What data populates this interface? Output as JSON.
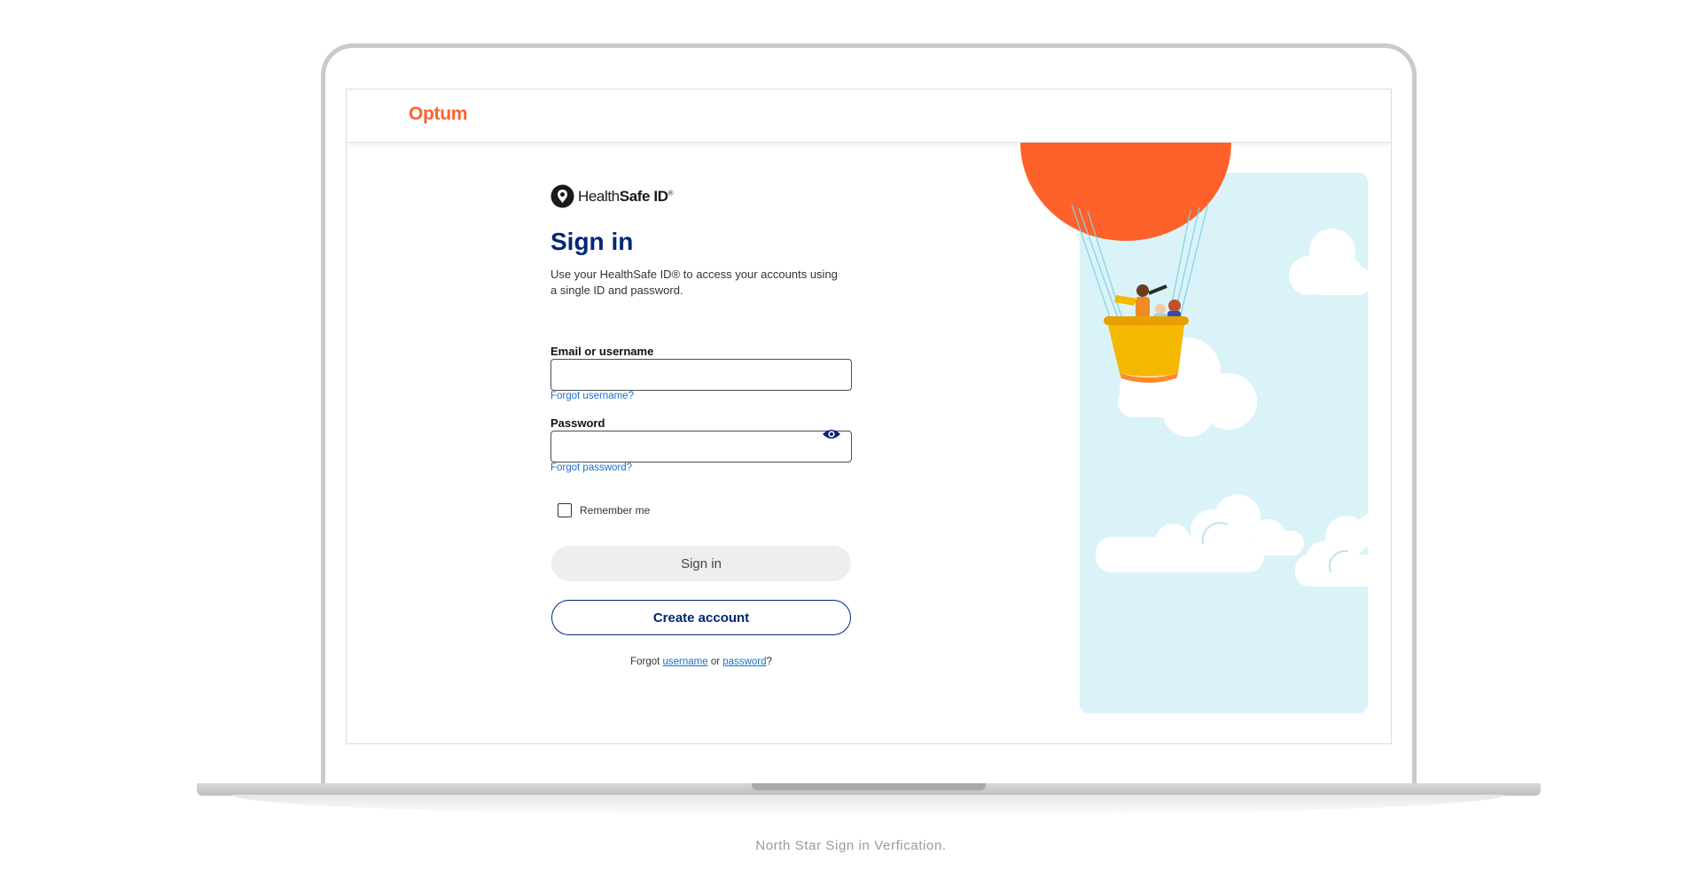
{
  "app": {
    "brand": "Optum"
  },
  "login": {
    "logo_text_regular": "Health",
    "logo_text_bold": "Safe ID",
    "logo_trademark": "®",
    "title": "Sign in",
    "intro": "Use your HealthSafe ID® to access your accounts using a single ID and password.",
    "email_label": "Email or username",
    "email_value": "",
    "forgot_username": "Forgot username?",
    "password_label": "Password",
    "password_value": "",
    "forgot_password": "Forgot password?",
    "remember_me": "Remember me",
    "signin_button": "Sign in",
    "create_account_button": "Create account",
    "footer_prefix": "Forgot ",
    "footer_username": "username",
    "footer_or": " or ",
    "footer_password": "password",
    "footer_suffix": "?"
  },
  "caption": "North Star Sign in Verfication.",
  "colors": {
    "brand_orange": "#ff612b",
    "primary_navy": "#002677",
    "link_blue": "#196ecf",
    "sky": "#daf3f8",
    "balloon": "#ff612b",
    "basket": "#f5b800"
  },
  "icons": [
    "healthsafe-shield-icon",
    "eye-icon",
    "hot-air-balloon-illustration",
    "cloud-illustration"
  ]
}
